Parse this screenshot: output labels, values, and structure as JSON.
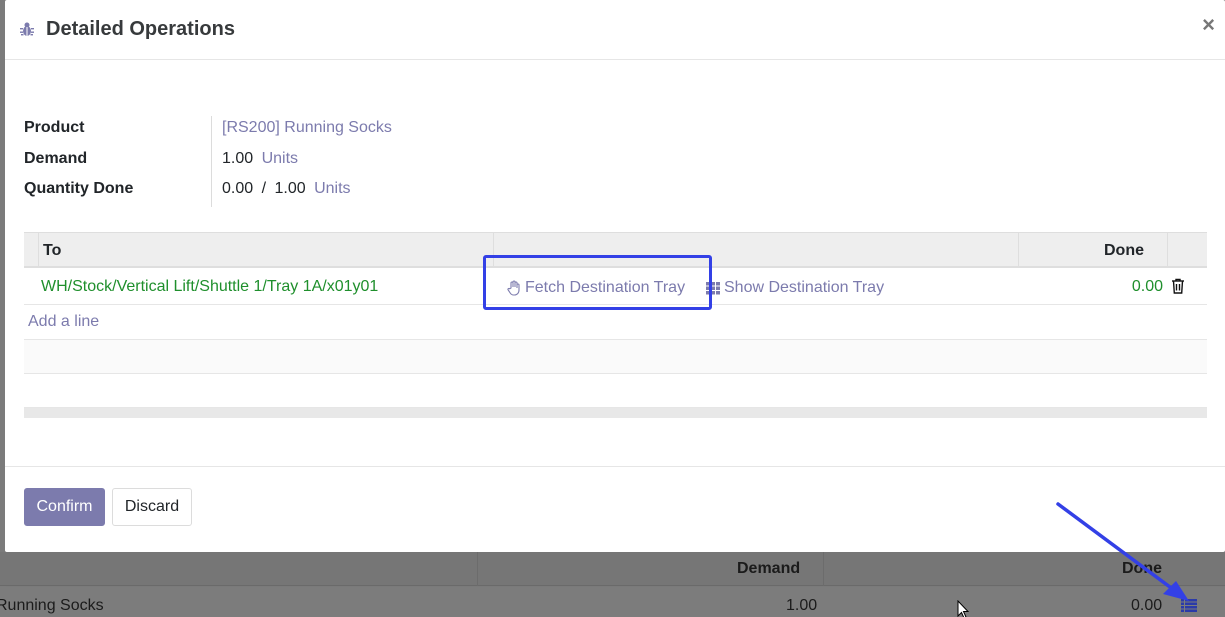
{
  "modal": {
    "title": "Detailed Operations",
    "close_label": "×"
  },
  "info": {
    "product_label": "Product",
    "product_value": "[RS200] Running Socks",
    "demand_label": "Demand",
    "demand_value": "1.00",
    "demand_unit": "Units",
    "qty_done_label": "Quantity Done",
    "qty_done_value": "0.00",
    "qty_done_sep": "/",
    "qty_done_total": "1.00",
    "qty_done_unit": "Units"
  },
  "grid": {
    "headers": {
      "to": "To",
      "done": "Done"
    },
    "rows": [
      {
        "destination": "WH/Stock/Vertical Lift/Shuttle 1/Tray 1A/x01y01",
        "fetch_label": "Fetch Destination Tray",
        "show_label": "Show Destination Tray",
        "done": "0.00"
      }
    ],
    "add_line_label": "Add a line"
  },
  "footer": {
    "confirm_label": "Confirm",
    "discard_label": "Discard"
  },
  "background": {
    "headers": {
      "demand": "Demand",
      "done": "Done"
    },
    "row": {
      "product": "Running Socks",
      "demand": "1.00",
      "done": "0.00"
    }
  },
  "icons": {
    "bug": "bug-icon",
    "hand": "hand-pointer-icon",
    "grid": "th-grid-icon",
    "trash": "trash-icon",
    "list": "list-icon",
    "close": "close-icon"
  },
  "colors": {
    "accent": "#7c7bad",
    "done_green": "#1f8f2c",
    "highlight": "#3340e6",
    "arrow": "#3340e6"
  }
}
